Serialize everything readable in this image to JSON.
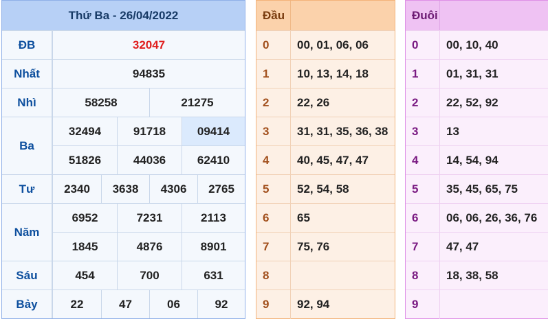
{
  "results": {
    "title": "Thứ Ba - 26/04/2022",
    "labels": {
      "db": "ĐB",
      "nhat": "Nhất",
      "nhi": "Nhì",
      "ba": "Ba",
      "tu": "Tư",
      "nam": "Năm",
      "sau": "Sáu",
      "bay": "Bảy"
    },
    "db": "32047",
    "nhat": "94835",
    "nhi": [
      "58258",
      "21275"
    ],
    "ba": [
      "32494",
      "91718",
      "09414",
      "51826",
      "44036",
      "62410"
    ],
    "tu": [
      "2340",
      "3638",
      "4306",
      "2765"
    ],
    "nam": [
      "6952",
      "7231",
      "2113",
      "1845",
      "4876",
      "8901"
    ],
    "sau": [
      "454",
      "700",
      "631"
    ],
    "bay": [
      "22",
      "47",
      "06",
      "92"
    ]
  },
  "dau": {
    "header": "Đầu",
    "rows": [
      {
        "k": "0",
        "v": "00, 01, 06, 06"
      },
      {
        "k": "1",
        "v": "10, 13, 14, 18"
      },
      {
        "k": "2",
        "v": "22, 26"
      },
      {
        "k": "3",
        "v": "31, 31, 35, 36, 38"
      },
      {
        "k": "4",
        "v": "40, 45, 47, 47"
      },
      {
        "k": "5",
        "v": "52, 54, 58"
      },
      {
        "k": "6",
        "v": "65"
      },
      {
        "k": "7",
        "v": "75, 76"
      },
      {
        "k": "8",
        "v": ""
      },
      {
        "k": "9",
        "v": "92, 94"
      }
    ]
  },
  "duoi": {
    "header": "Đuôi",
    "rows": [
      {
        "k": "0",
        "v": "00, 10, 40"
      },
      {
        "k": "1",
        "v": "01, 31, 31"
      },
      {
        "k": "2",
        "v": "22, 52, 92"
      },
      {
        "k": "3",
        "v": "13"
      },
      {
        "k": "4",
        "v": "14, 54, 94"
      },
      {
        "k": "5",
        "v": "35, 45, 65, 75"
      },
      {
        "k": "6",
        "v": "06, 06, 26, 36, 76"
      },
      {
        "k": "7",
        "v": "47, 47"
      },
      {
        "k": "8",
        "v": "18, 38, 58"
      },
      {
        "k": "9",
        "v": ""
      }
    ]
  }
}
